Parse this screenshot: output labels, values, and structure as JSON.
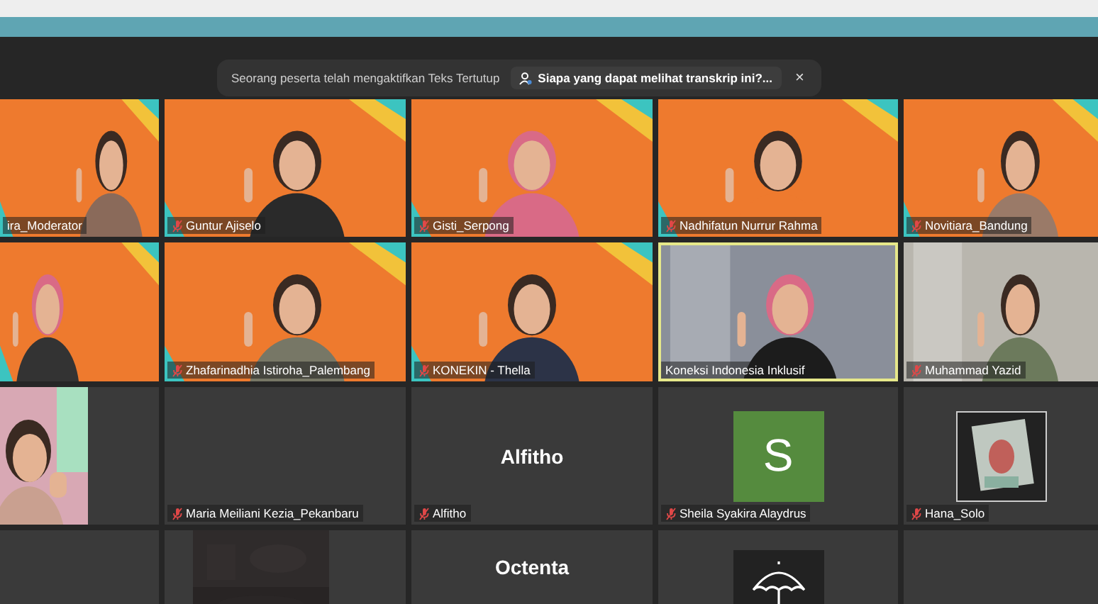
{
  "notification": {
    "message": "Seorang peserta telah mengaktifkan Teks Tertutup",
    "action": "Siapa yang dapat melihat transkrip ini?...",
    "close": "×"
  },
  "tiles": [
    {
      "kind": "video",
      "name": "ira_Moderator",
      "muted": false,
      "speaking": false
    },
    {
      "kind": "video",
      "name": "Guntur Ajiselo",
      "muted": true,
      "speaking": false
    },
    {
      "kind": "video",
      "name": "Gisti_Serpong",
      "muted": true,
      "speaking": false
    },
    {
      "kind": "video",
      "name": "Nadhifatun Nurrur Rahma",
      "muted": true,
      "speaking": false
    },
    {
      "kind": "video",
      "name": "Novitiara_Bandung",
      "muted": true,
      "speaking": false
    },
    {
      "kind": "video"
    },
    {
      "kind": "video",
      "name": "Zhafarinadhia Istiroha_Palembang",
      "muted": true,
      "speaking": false
    },
    {
      "kind": "video",
      "name": "KONEKIN - Thella",
      "muted": true,
      "speaking": false
    },
    {
      "kind": "video",
      "name": "Koneksi Indonesia Inklusif",
      "muted": false,
      "speaking": true
    },
    {
      "kind": "video",
      "name": "Muhammad Yazid",
      "muted": true,
      "speaking": false
    },
    {
      "kind": "small_video"
    },
    {
      "kind": "blank",
      "name": "Maria Meiliani Kezia_Pekanbaru",
      "muted": true,
      "speaking": false
    },
    {
      "kind": "text",
      "display": "Alfitho",
      "name": "Alfitho",
      "muted": true,
      "speaking": false
    },
    {
      "kind": "letter",
      "display": "S",
      "color": "#558b3e",
      "name": "Sheila Syakira Alaydrus",
      "muted": true,
      "speaking": false
    },
    {
      "name": "Hana_Solo",
      "muted": true,
      "speaking": false
    },
    {
      "kind": "blank"
    },
    {
      "kind": "dark_image"
    },
    {
      "kind": "text",
      "display": "Octenta"
    },
    {
      "kind": "umbrella"
    },
    {
      "kind": "blank"
    }
  ]
}
